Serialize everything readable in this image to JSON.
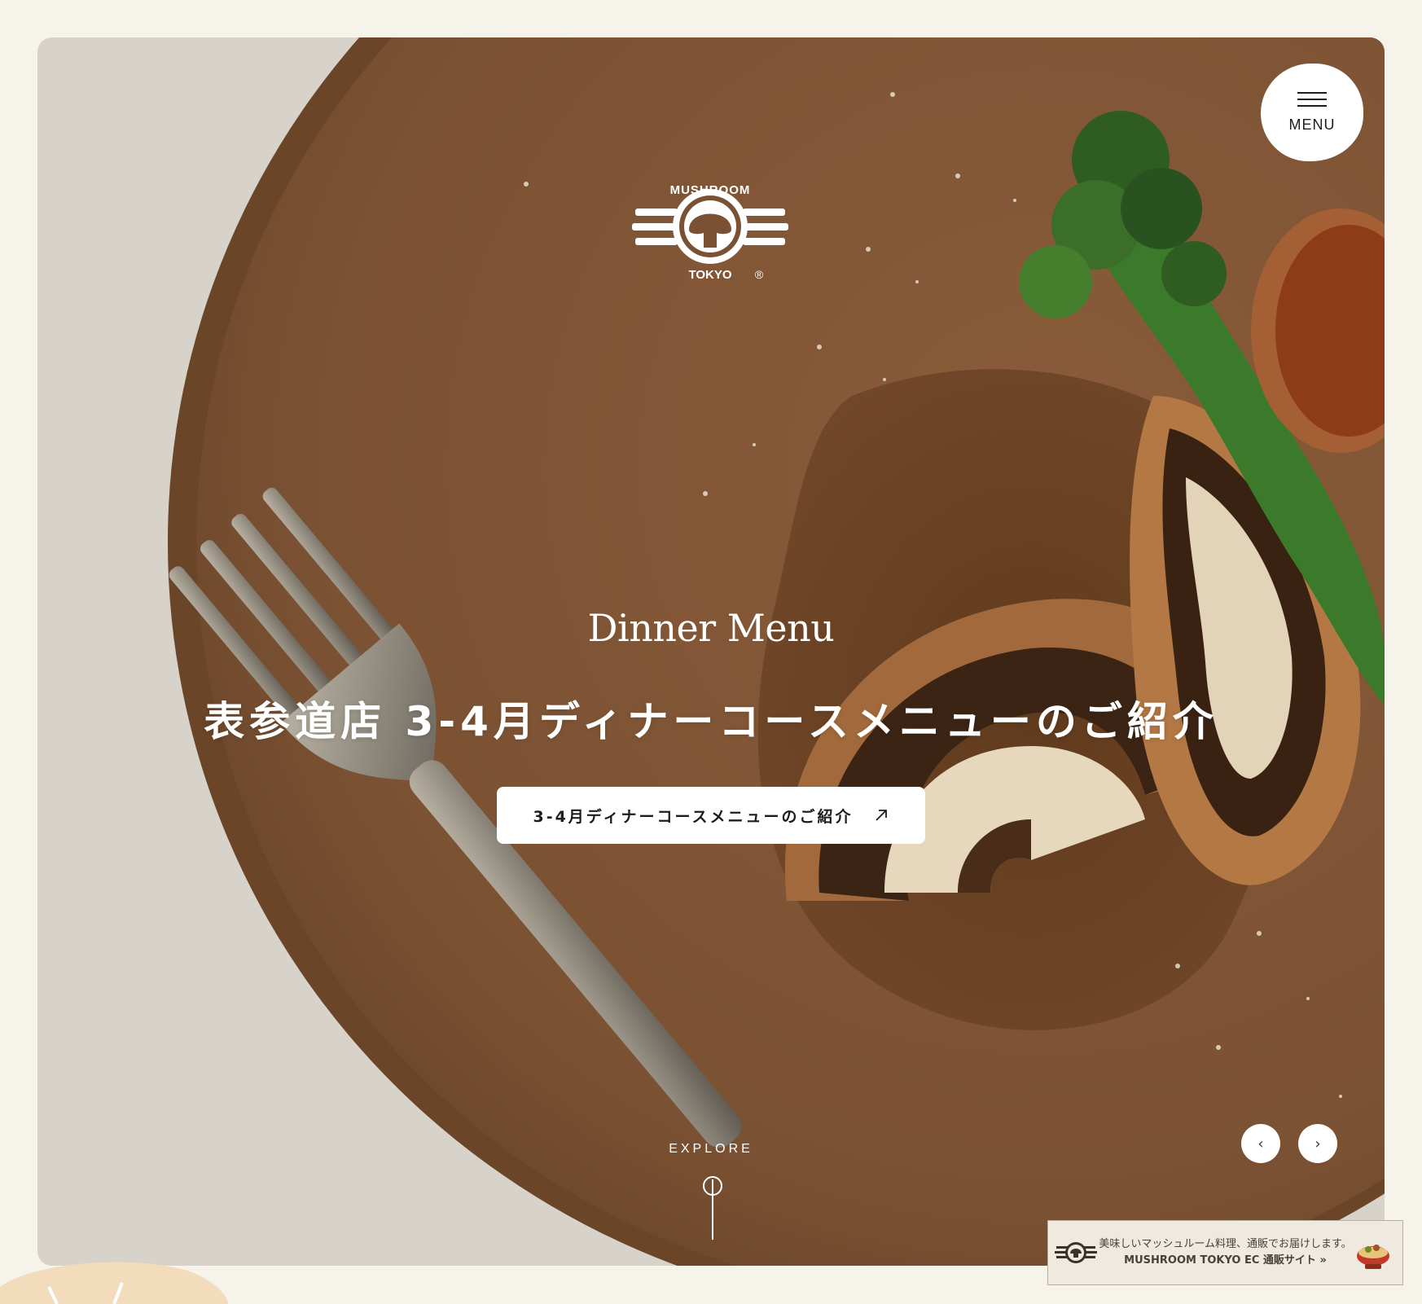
{
  "header": {
    "menu_label": "MENU"
  },
  "brand": {
    "logo_text_top": "MUSHROOM",
    "logo_text_bottom": "TOKYO",
    "registered_mark": "®"
  },
  "hero": {
    "subtitle": "Dinner Menu",
    "headline": "表参道店 3-4月ディナーコースメニューのご紹介",
    "cta_label": "3-4月ディナーコースメニューのご紹介",
    "cta_icon": "arrow-up-right-icon",
    "explore_label": "EXPLORE",
    "explore_icon": "pin-line-icon"
  },
  "carousel": {
    "prev_icon": "‹",
    "next_icon": "›"
  },
  "ec_banner": {
    "line1": "美味しいマッシュルーム料理、通販でお届けします。",
    "line2": "MUSHROOM TOKYO EC 通販サイト »"
  },
  "colors": {
    "page_bg": "#f6f4ea",
    "plate_brown": "#7a5233",
    "cloth_grey": "#d9d5cc",
    "white": "#ffffff"
  }
}
